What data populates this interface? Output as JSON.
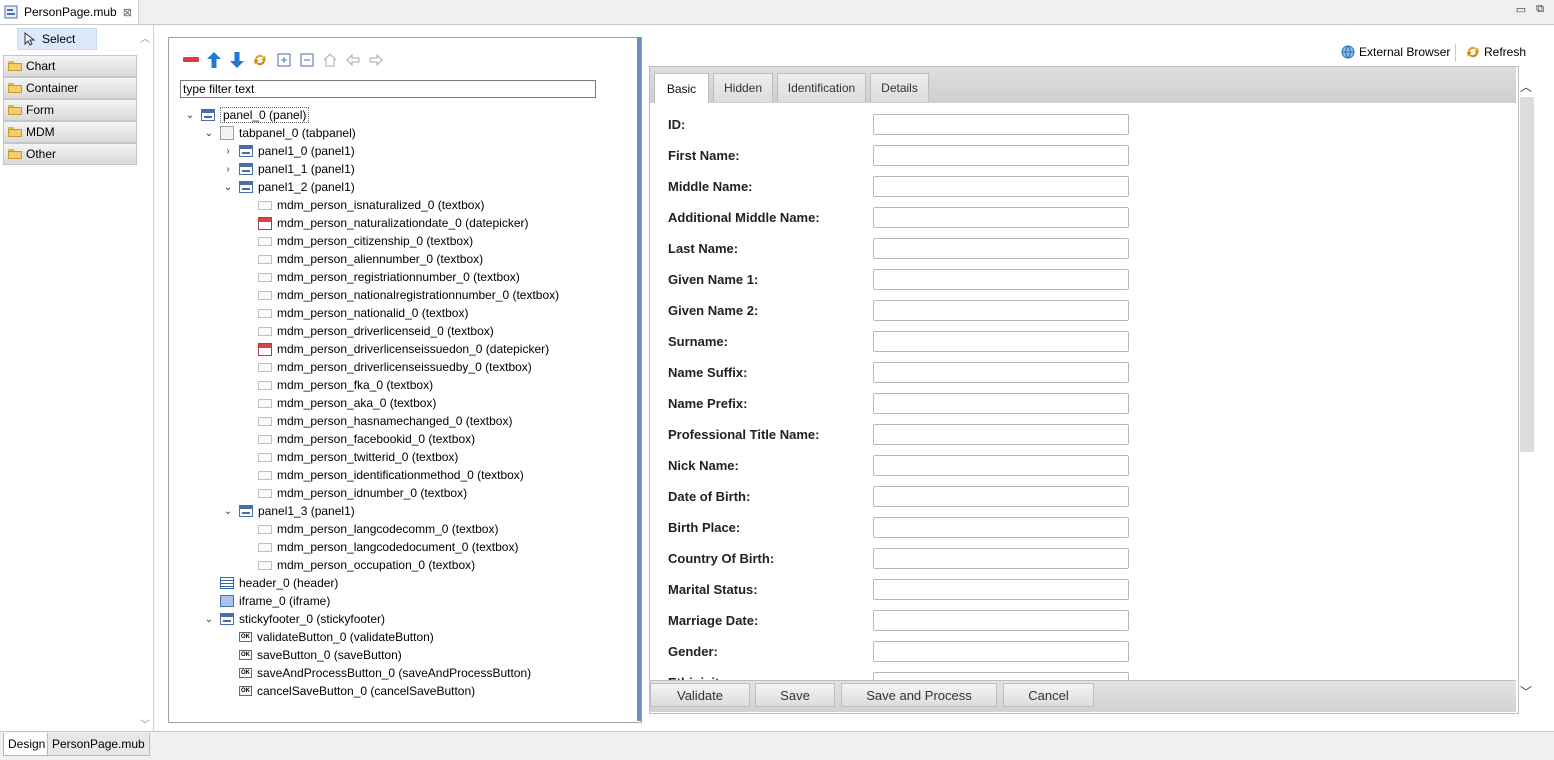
{
  "editor": {
    "file_tab": "PersonPage.mub",
    "close_glyph": "⊠",
    "minimize_glyph": "▭",
    "restore_glyph": "⧉"
  },
  "palette": {
    "select_label": "Select",
    "categories": [
      "Chart",
      "Container",
      "Form",
      "MDM",
      "Other"
    ]
  },
  "outline": {
    "filter_placeholder": "type filter text",
    "tree": [
      {
        "label": "panel_0 (panel)",
        "icon": "panel-icon",
        "chevron": "⌄"
      },
      {
        "label": "tabpanel_0 (tabpanel)",
        "icon": "tabpanel-icon",
        "chevron": "⌄"
      },
      {
        "label": "panel1_0 (panel1)",
        "icon": "panel-icon",
        "chevron": "›"
      },
      {
        "label": "panel1_1 (panel1)",
        "icon": "panel-icon",
        "chevron": "›"
      },
      {
        "label": "panel1_2 (panel1)",
        "icon": "panel-icon",
        "chevron": "⌄"
      },
      {
        "label": "mdm_person_isnaturalized_0 (textbox)",
        "icon": "textbox-icon"
      },
      {
        "label": "mdm_person_naturalizationdate_0 (datepicker)",
        "icon": "datepicker-icon"
      },
      {
        "label": "mdm_person_citizenship_0 (textbox)",
        "icon": "textbox-icon"
      },
      {
        "label": "mdm_person_aliennumber_0 (textbox)",
        "icon": "textbox-icon"
      },
      {
        "label": "mdm_person_registriationnumber_0 (textbox)",
        "icon": "textbox-icon"
      },
      {
        "label": "mdm_person_nationalregistrationnumber_0 (textbox)",
        "icon": "textbox-icon"
      },
      {
        "label": "mdm_person_nationalid_0 (textbox)",
        "icon": "textbox-icon"
      },
      {
        "label": "mdm_person_driverlicenseid_0 (textbox)",
        "icon": "textbox-icon"
      },
      {
        "label": "mdm_person_driverlicenseissuedon_0 (datepicker)",
        "icon": "datepicker-icon"
      },
      {
        "label": "mdm_person_driverlicenseissuedby_0 (textbox)",
        "icon": "textbox-icon"
      },
      {
        "label": "mdm_person_fka_0 (textbox)",
        "icon": "textbox-icon"
      },
      {
        "label": "mdm_person_aka_0 (textbox)",
        "icon": "textbox-icon"
      },
      {
        "label": "mdm_person_hasnamechanged_0 (textbox)",
        "icon": "textbox-icon"
      },
      {
        "label": "mdm_person_facebookid_0 (textbox)",
        "icon": "textbox-icon"
      },
      {
        "label": "mdm_person_twitterid_0 (textbox)",
        "icon": "textbox-icon"
      },
      {
        "label": "mdm_person_identificationmethod_0 (textbox)",
        "icon": "textbox-icon"
      },
      {
        "label": "mdm_person_idnumber_0 (textbox)",
        "icon": "textbox-icon"
      },
      {
        "label": "panel1_3 (panel1)",
        "icon": "panel-icon",
        "chevron": "⌄"
      },
      {
        "label": "mdm_person_langcodecomm_0 (textbox)",
        "icon": "textbox-icon"
      },
      {
        "label": "mdm_person_langcodedocument_0 (textbox)",
        "icon": "textbox-icon"
      },
      {
        "label": "mdm_person_occupation_0 (textbox)",
        "icon": "textbox-icon"
      },
      {
        "label": "header_0 (header)",
        "icon": "header-icon"
      },
      {
        "label": "iframe_0 (iframe)",
        "icon": "iframe-icon"
      },
      {
        "label": "stickyfooter_0 (stickyfooter)",
        "icon": "panel-icon",
        "chevron": "⌄"
      },
      {
        "label": "validateButton_0 (validateButton)",
        "icon": "button-icon"
      },
      {
        "label": "saveButton_0 (saveButton)",
        "icon": "button-icon"
      },
      {
        "label": "saveAndProcessButton_0 (saveAndProcessButton)",
        "icon": "button-icon"
      },
      {
        "label": "cancelSaveButton_0 (cancelSaveButton)",
        "icon": "button-icon"
      }
    ]
  },
  "preview": {
    "external_browser": "External Browser",
    "refresh": "Refresh",
    "tabs": [
      "Basic",
      "Hidden",
      "Identification",
      "Details"
    ],
    "fields": [
      "ID:",
      "First Name:",
      "Middle Name:",
      "Additional Middle Name:",
      "Last Name:",
      "Given Name 1:",
      "Given Name 2:",
      "Surname:",
      "Name Suffix:",
      "Name Prefix:",
      "Professional Title Name:",
      "Nick Name:",
      "Date of Birth:",
      "Birth Place:",
      "Country Of Birth:",
      "Marital Status:",
      "Marriage Date:",
      "Gender:",
      "Ethinicity:"
    ],
    "footer_buttons": [
      "Validate",
      "Save",
      "Save and Process",
      "Cancel"
    ]
  },
  "bottom_tabs": [
    "Design",
    "PersonPage.mub"
  ],
  "colors": {
    "accent": "#6d8fc6",
    "selection": "#dbe9fa"
  }
}
